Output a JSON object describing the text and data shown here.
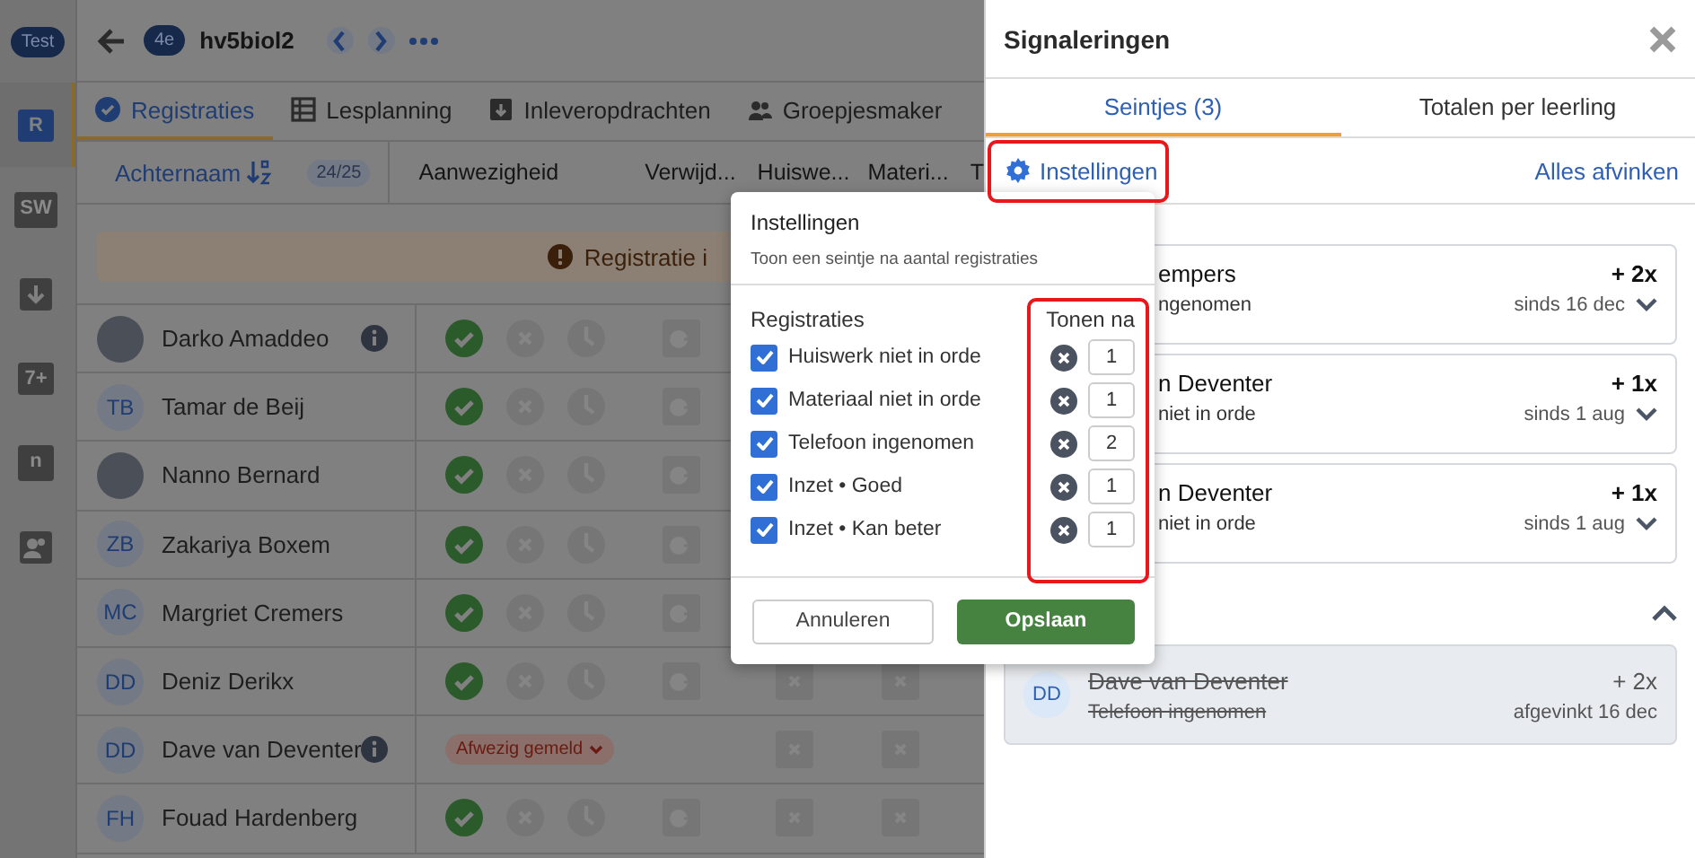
{
  "rail": {
    "badge": "Test",
    "items": [
      {
        "kind": "register",
        "glyph": "R",
        "selected": true
      },
      {
        "kind": "sw",
        "glyph": "SW",
        "selected": false
      },
      {
        "kind": "download",
        "selected": false
      },
      {
        "kind": "grade",
        "glyph": "7+",
        "selected": false
      },
      {
        "kind": "notes",
        "glyph": "n",
        "selected": false
      },
      {
        "kind": "people",
        "selected": false
      }
    ]
  },
  "header": {
    "class_badge": "4e",
    "title": "hv5biol2"
  },
  "tabs": [
    {
      "label": "Registraties",
      "selected": true
    },
    {
      "label": "Lesplanning",
      "selected": false
    },
    {
      "label": "Inleveropdrachten",
      "selected": false
    },
    {
      "label": "Groepjesmaker",
      "selected": false
    }
  ],
  "table": {
    "sort_column": "Achternaam",
    "count": "24/25",
    "columns": [
      "Aanwezigheid",
      "Verwijd...",
      "Huiswe...",
      "Materi...",
      "T"
    ],
    "banner": "Registratie i",
    "rows": [
      {
        "name": "Darko Amaddeo",
        "info": true
      },
      {
        "name": "Tamar de Beij",
        "initials": "TB",
        "info": false
      },
      {
        "name": "Nanno Bernard",
        "info": false
      },
      {
        "name": "Zakariya Boxem",
        "initials": "ZB",
        "info": false
      },
      {
        "name": "Margriet Cremers",
        "initials": "MC",
        "info": false
      },
      {
        "name": "Deniz Derikx",
        "initials": "DD",
        "info": false
      },
      {
        "name": "Dave van Deventer",
        "initials": "DD",
        "info": true,
        "attendance_label": "Afwezig gemeld"
      },
      {
        "name": "Fouad Hardenberg",
        "initials": "FH",
        "info": false
      }
    ]
  },
  "panel": {
    "title": "Signaleringen",
    "tabs": [
      {
        "label": "Seintjes (3)",
        "selected": true
      },
      {
        "label": "Totalen per leerling",
        "selected": false
      }
    ],
    "settings_link": "Instellingen",
    "check_all_link": "Alles afvinken",
    "alerts": [
      {
        "name": "empers",
        "reason": "ngenomen",
        "count": "+ 2x",
        "since": "sinds 16 dec"
      },
      {
        "name": "n Deventer",
        "reason": "niet in orde",
        "count": "+ 1x",
        "since": "sinds 1 aug"
      },
      {
        "name": "n Deventer",
        "reason": "niet in orde",
        "count": "+ 1x",
        "since": "sinds 1 aug"
      }
    ],
    "done_expanded": true,
    "done": [
      {
        "initials": "DD",
        "name": "Dave van Deventer",
        "reason": "Telefoon ingenomen",
        "count": "+ 2x",
        "date": "afgevinkt 16 dec"
      }
    ]
  },
  "popover": {
    "title": "Instellingen",
    "subtitle": "Toon een seintje na aantal registraties",
    "heading": "Registraties",
    "column_heading": "Tonen na",
    "rules": [
      {
        "label": "Huiswerk niet in orde",
        "checked": true,
        "value": "1"
      },
      {
        "label": "Materiaal niet in orde",
        "checked": true,
        "value": "1"
      },
      {
        "label": "Telefoon ingenomen",
        "checked": true,
        "value": "2"
      },
      {
        "label": "Inzet • Goed",
        "checked": true,
        "value": "1"
      },
      {
        "label": "Inzet • Kan beter",
        "checked": true,
        "value": "1"
      }
    ],
    "cancel": "Annuleren",
    "save": "Opslaan"
  }
}
